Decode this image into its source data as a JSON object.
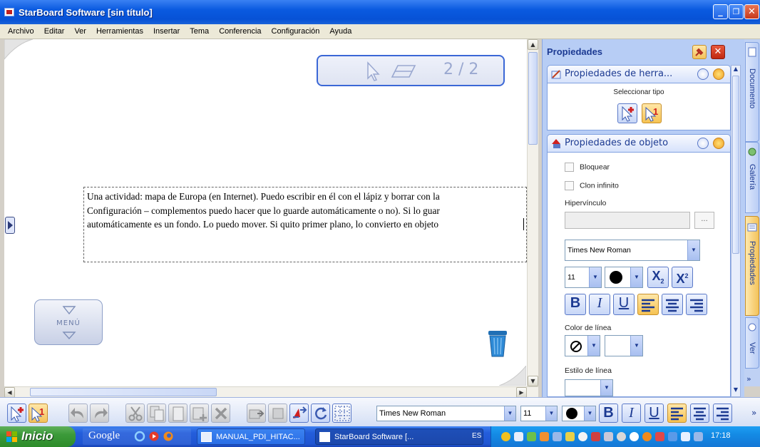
{
  "window": {
    "title": "StarBoard Software [sin título]"
  },
  "menu": [
    "Archivo",
    "Editar",
    "Ver",
    "Herramientas",
    "Insertar",
    "Tema",
    "Conferencia",
    "Configuración",
    "Ayuda"
  ],
  "canvas": {
    "page_indicator": "2 / 2",
    "text_lines": [
      "Una actividad: mapa de Europa (en Internet). Puedo escribir en él con el lápiz y borrar con la",
      "Configuración – complementos puedo hacer que lo guarde automáticamente o no). Si lo guar",
      "automáticamente es un fondo. Lo puedo mover. Si quito primer plano, lo convierto en objeto"
    ],
    "menu_widget_label": "MENÚ"
  },
  "properties": {
    "header": "Propiedades",
    "tool_section": {
      "title": "Propiedades de herra...",
      "select_type_label": "Seleccionar tipo"
    },
    "object_section": {
      "title": "Propiedades de objeto",
      "lock_label": "Bloquear",
      "lock_checked": false,
      "infinite_clone_label": "Clon infinito",
      "infinite_clone_checked": false,
      "hyperlink_label": "Hipervínculo",
      "hyperlink_value": "",
      "browse_label": "...",
      "font_name": "Times New Roman",
      "font_size": "11",
      "line_color_label": "Color de línea",
      "line_style_label": "Estilo de línea"
    }
  },
  "right_tabs": [
    "Documento",
    "Galería",
    "Propiedades",
    "Ver"
  ],
  "toolbar": {
    "font_name": "Times New Roman",
    "font_size": "11"
  },
  "taskbar": {
    "start_label": "Inicio",
    "google_label": "Google",
    "tasks": [
      "MANUAL_PDI_HITAC...",
      "StarBoard Software [..."
    ],
    "language": "ES",
    "clock": "17:18"
  },
  "colors": {
    "title_blue": "#0a5ae0",
    "panel_blue": "#b7cdf5",
    "accent_orange": "#f3c25a",
    "taskbar_blue": "#245edb",
    "start_green": "#3c9a3a"
  }
}
